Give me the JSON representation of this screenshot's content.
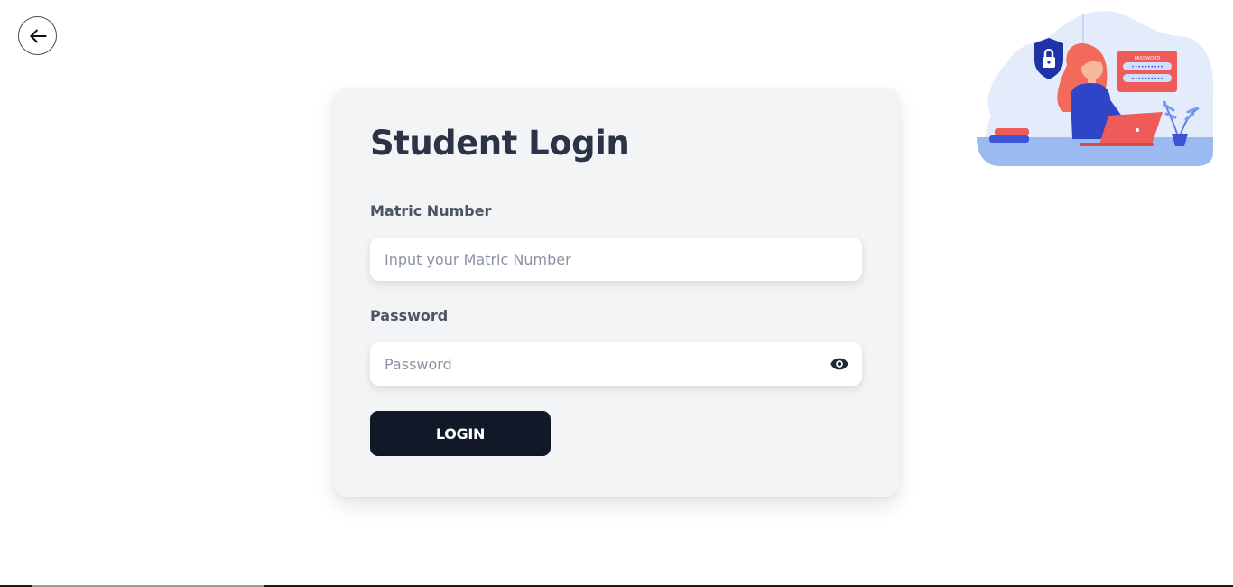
{
  "login": {
    "title": "Student Login",
    "matric_label": "Matric Number",
    "matric_placeholder": "Input your Matric Number",
    "matric_value": "",
    "password_label": "Password",
    "password_placeholder": "Password",
    "password_value": "",
    "submit_label": "LOGIN"
  },
  "illustration": {
    "password_caption": "PASSWORD",
    "password_mask": "••••••••••"
  },
  "icons": {
    "back": "arrow-left-icon",
    "password_toggle": "eye-icon"
  },
  "colors": {
    "card_background": "#f3f4f6",
    "button_background": "#111827",
    "title_text": "#2b3446",
    "illustration_blue": "#2f45c7",
    "illustration_red": "#ee5b59"
  }
}
